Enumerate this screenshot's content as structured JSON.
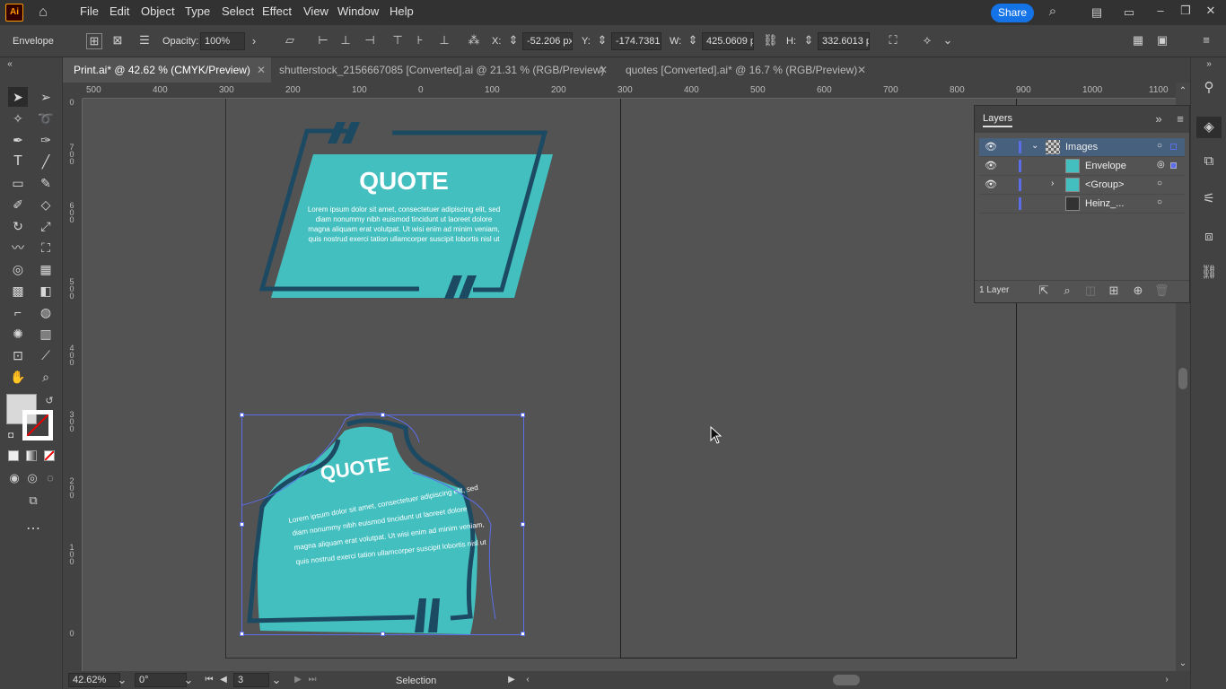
{
  "app": {
    "logo": "Ai"
  },
  "menu": [
    "File",
    "Edit",
    "Object",
    "Type",
    "Select",
    "Effect",
    "View",
    "Window",
    "Help"
  ],
  "header": {
    "share_label": "Share"
  },
  "control": {
    "selection_label": "Envelope",
    "opacity_label": "Opacity:",
    "opacity_value": "100%",
    "x_label": "X:",
    "x_value": "-52.206 px",
    "y_label": "Y:",
    "y_value": "-174.7381 p",
    "w_label": "W:",
    "w_value": "425.0609 px",
    "h_label": "H:",
    "h_value": "332.6013 px"
  },
  "tabs": [
    {
      "label": "Print.ai* @ 42.62 % (CMYK/Preview)",
      "active": true
    },
    {
      "label": "shutterstock_2156667085 [Converted].ai @ 21.31 % (RGB/Preview)",
      "active": false
    },
    {
      "label": "quotes [Converted].ai* @ 16.7 % (RGB/Preview)",
      "active": false
    }
  ],
  "ruler": {
    "h": [
      "500",
      "400",
      "300",
      "200",
      "100",
      "0",
      "100",
      "200",
      "300",
      "400",
      "500",
      "600",
      "700",
      "800",
      "900",
      "1000",
      "1100"
    ],
    "v": [
      "0",
      "700",
      "600",
      "500",
      "400",
      "300",
      "200",
      "100",
      "0"
    ]
  },
  "artwork": {
    "title": "QUOTE",
    "body": [
      "Lorem ipsum dolor sit amet, consectetuer adipiscing elit, sed",
      "diam nonummy nibh euismod tincidunt ut laoreet dolore",
      "magna aliquam erat volutpat. Ut wisi enim ad minim veniam,",
      "quis nostrud exerci tation ullamcorper suscipit lobortis nisl ut"
    ],
    "warped_title": "QUOTE",
    "warped_body": [
      "Lorem ipsum dolor sit amet, consectetuer adipiscing elit, sed",
      "diam nonummy nibh euismod tincidunt ut laoreet dolore",
      "magna aliquam erat volutpat. Ut wisi enim ad minim veniam,",
      "quis nostrud exerci tation ullamcorper suscipit lobortis nisl ut"
    ],
    "teal": "#43bfbf",
    "navy": "#1d4a63"
  },
  "layers_panel": {
    "title": "Layers",
    "rows": [
      {
        "name": "Images",
        "selected": true
      },
      {
        "name": "Envelope",
        "selected": false
      },
      {
        "name": "<Group>",
        "selected": false
      },
      {
        "name": "Heinz_...",
        "selected": false
      }
    ],
    "footer": "1 Layer"
  },
  "status": {
    "zoom": "42.62%",
    "rotation": "0°",
    "artboard": "3",
    "tool": "Selection"
  },
  "colors": {
    "accent": "#1473e6",
    "selection": "#5b6ee8",
    "layer_highlight": "#46607e"
  }
}
